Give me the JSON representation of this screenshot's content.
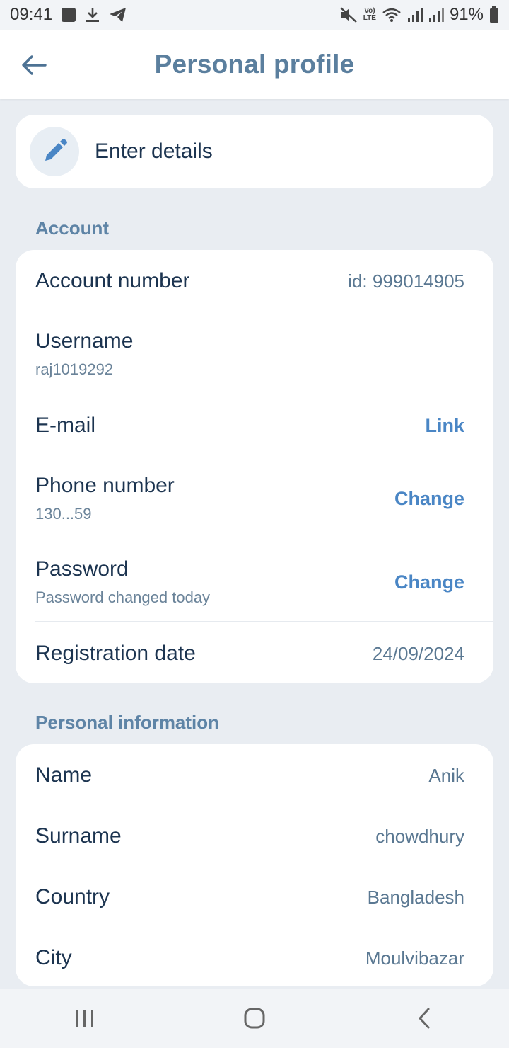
{
  "status_bar": {
    "time": "09:41",
    "battery": "91%",
    "lte_label_top": "Vo)",
    "lte_label_bottom": "LTE",
    "icons": [
      "stop-icon",
      "download-icon",
      "telegram-icon",
      "mute-icon",
      "volte-icon",
      "wifi-icon",
      "signal-icon",
      "signal-icon",
      "battery-icon"
    ]
  },
  "header": {
    "title": "Personal profile",
    "back_icon": "arrow-left-icon"
  },
  "enter_details": {
    "label": "Enter details",
    "icon": "pencil-icon"
  },
  "account": {
    "section_title": "Account",
    "account_number": {
      "label": "Account number",
      "value": "id: 999014905"
    },
    "username": {
      "label": "Username",
      "value": "raj1019292"
    },
    "email": {
      "label": "E-mail",
      "action": "Link"
    },
    "phone": {
      "label": "Phone number",
      "value": "130...59",
      "action": "Change"
    },
    "password": {
      "label": "Password",
      "sub": "Password changed today",
      "action": "Change"
    },
    "registration": {
      "label": "Registration date",
      "value": "24/09/2024"
    }
  },
  "personal": {
    "section_title": "Personal information",
    "name": {
      "label": "Name",
      "value": "Anik"
    },
    "surname": {
      "label": "Surname",
      "value": "chowdhury"
    },
    "country": {
      "label": "Country",
      "value": "Bangladesh"
    },
    "city": {
      "label": "City",
      "value": "Moulvibazar"
    }
  },
  "nav": {
    "icons": [
      "recent-apps-icon",
      "home-icon",
      "back-icon"
    ]
  },
  "colors": {
    "accent": "#4a86c5",
    "title": "#5b7f9e",
    "text": "#1c3450",
    "background": "#e9edf2"
  }
}
